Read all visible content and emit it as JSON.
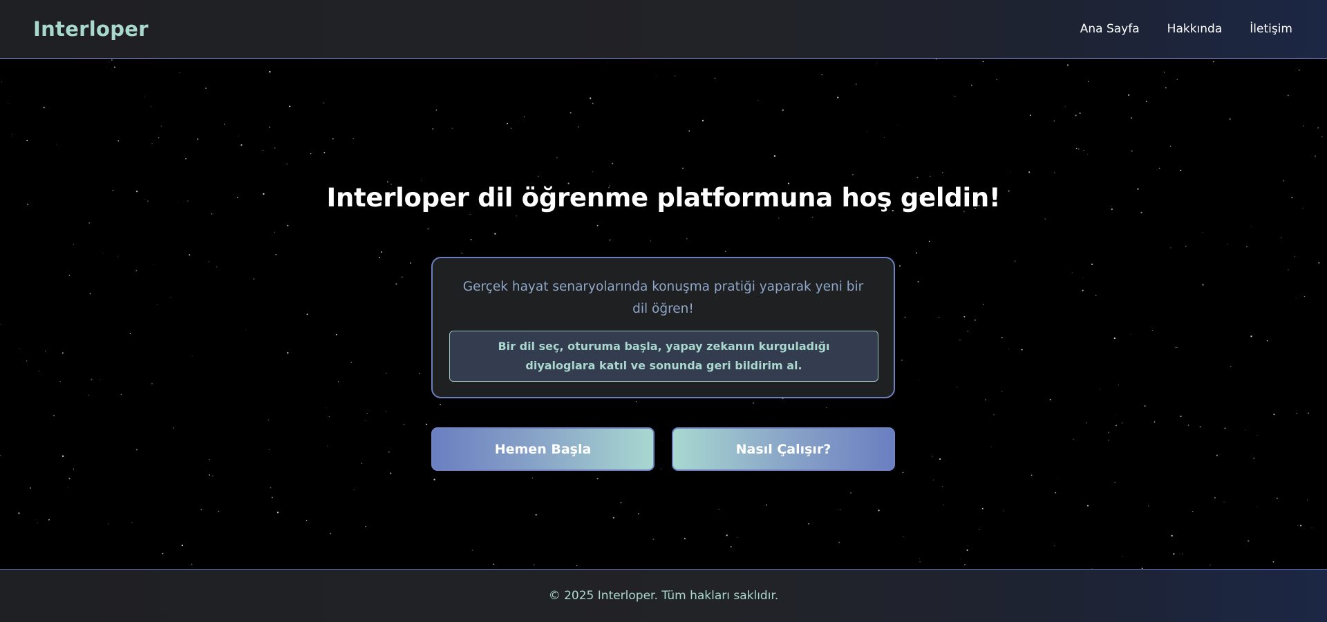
{
  "header": {
    "logo": "Interloper",
    "nav": [
      "Ana Sayfa",
      "Hakkında",
      "İletişim"
    ]
  },
  "hero": {
    "title": "Interloper dil öğrenme platformuna hoş geldin!",
    "card_text": "Gerçek hayat senaryolarında konuşma pratiği yaparak yeni bir dil öğren!",
    "card_inner_text": "Bir dil seç, oturuma başla, yapay zekanın kurguladığı diyaloglara katıl ve sonunda geri bildirim al.",
    "start_button": "Hemen Başla",
    "how_button": "Nasıl Çalışır?"
  },
  "footer": {
    "text": "© 2025 Interloper. Tüm hakları saklıdır."
  },
  "colors": {
    "accent_teal": "#a9d8cf",
    "accent_blue": "#6c7fbf",
    "background": "#000000"
  }
}
